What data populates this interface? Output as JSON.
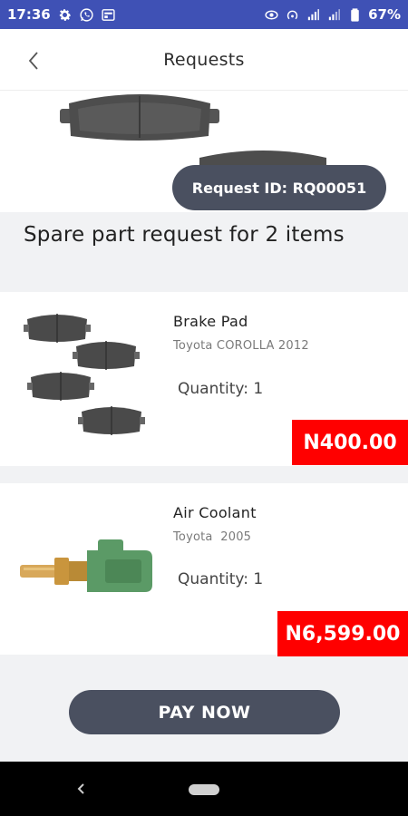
{
  "status_bar": {
    "time": "17:36",
    "battery": "67%",
    "icons_left": [
      "gear-icon",
      "whatsapp-icon",
      "card-icon"
    ],
    "icons_right": [
      "eye-icon",
      "hotspot-icon",
      "signal-icon",
      "signal-icon",
      "battery-icon"
    ]
  },
  "header": {
    "title": "Requests",
    "back_icon": "chevron-left-icon"
  },
  "request": {
    "id_label": "Request ID: RQ00051",
    "summary": "Spare part request for 2 items"
  },
  "items": [
    {
      "name": "Brake Pad",
      "vehicle": "Toyota COROLLA 2012",
      "quantity": "Quantity: 1",
      "price": "N400.00",
      "image": "brake-pads-image"
    },
    {
      "name": "Air Coolant",
      "vehicle": "Toyota  2005",
      "quantity": "Quantity: 1",
      "price": "N6,599.00",
      "image": "coolant-sensor-image"
    }
  ],
  "actions": {
    "pay_label": "PAY NOW"
  },
  "colors": {
    "status_bar": "#3f51b5",
    "accent_dark": "#4a5060",
    "price_red": "#ff0000",
    "background": "#f1f2f4"
  }
}
